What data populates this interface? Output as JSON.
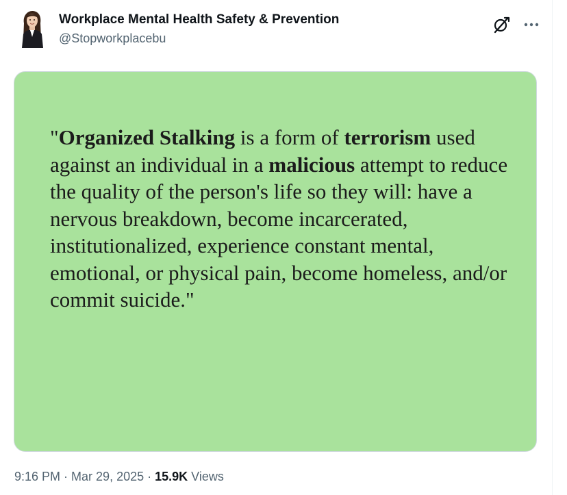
{
  "author": {
    "display_name": "Workplace Mental Health Safety & Prevention",
    "handle": "@Stopworkplacebu"
  },
  "actions": {
    "grok_icon": "grok-icon",
    "more_icon": "more-icon"
  },
  "media": {
    "background_color": "#a9e29c",
    "quote_segments": [
      {
        "text": "\"",
        "bold": false
      },
      {
        "text": "Organized Stalking",
        "bold": true
      },
      {
        "text": " is a form of ",
        "bold": false
      },
      {
        "text": "terrorism",
        "bold": true
      },
      {
        "text": " used against an individual in a ",
        "bold": false
      },
      {
        "text": "malicious",
        "bold": true
      },
      {
        "text": " attempt to reduce the quality of the person's life so they will: have a nervous breakdown, become incarcerated, institutionalized, experience constant mental, emotional, or physical pain, become homeless, and/or commit suicide.\"",
        "bold": false
      }
    ]
  },
  "meta": {
    "time": "9:16 PM",
    "separator1": " · ",
    "date": "Mar 29, 2025",
    "separator2": " · ",
    "views_count": "15.9K",
    "views_label": " Views"
  }
}
